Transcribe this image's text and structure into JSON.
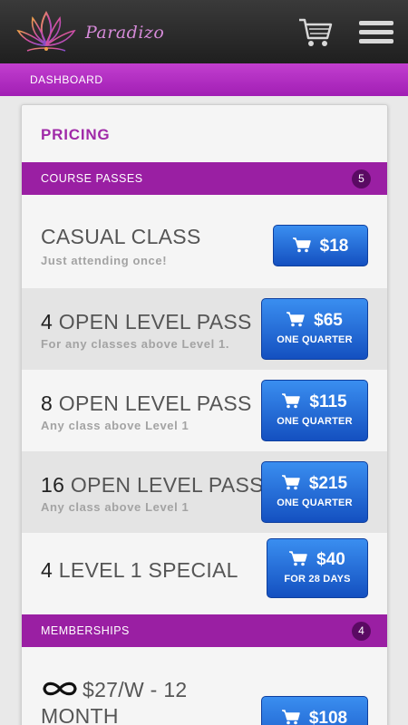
{
  "header": {
    "logo_text": "Paradizo",
    "cart_icon": "cart-icon",
    "menu_icon": "hamburger-menu-icon"
  },
  "breadcrumb": "DASHBOARD",
  "page_title": "PRICING",
  "colors": {
    "accent": "#9a1fa3",
    "badge": "#5a0a63",
    "button": "#1f63d6",
    "title_purple": "#a02aa8"
  },
  "sections": [
    {
      "label": "COURSE PASSES",
      "count": "5",
      "items": [
        {
          "num": "",
          "title": "CASUAL CLASS",
          "subtitle": "Just attending once!",
          "price": "$18",
          "period": ""
        },
        {
          "num": "4",
          "title": "OPEN LEVEL PASS",
          "subtitle": "For any classes above Level 1.",
          "price": "$65",
          "period": "ONE QUARTER"
        },
        {
          "num": "8",
          "title": "OPEN LEVEL PASS",
          "subtitle": "Any class above Level 1",
          "price": "$115",
          "period": "ONE QUARTER"
        },
        {
          "num": "16",
          "title": "OPEN LEVEL PASS",
          "subtitle": "Any class above Level 1",
          "price": "$215",
          "period": "ONE QUARTER"
        },
        {
          "num": "4",
          "title": "LEVEL 1 SPECIAL",
          "subtitle": "",
          "price": "$40",
          "period": "FOR 28 DAYS"
        }
      ]
    },
    {
      "label": "MEMBERSHIPS",
      "count": "4",
      "items": [
        {
          "num": "",
          "title_line1": "$27/W - 12",
          "title_line2": "MONTH",
          "icon": "infinity-icon",
          "price": "$108",
          "period": ""
        }
      ]
    }
  ]
}
